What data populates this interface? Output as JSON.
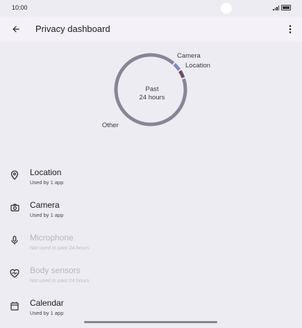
{
  "status_bar": {
    "time": "10:00",
    "icons": [
      "signal-icon",
      "battery-icon"
    ]
  },
  "app_bar": {
    "title": "Privacy dashboard",
    "back_icon": "arrow-back-icon",
    "menu_icon": "more-vert-icon"
  },
  "chart_data": {
    "type": "pie",
    "center_label_line1": "Past",
    "center_label_line2": "24 hours",
    "slices": [
      {
        "label": "Camera",
        "value": 4,
        "color": "#7d8bc9"
      },
      {
        "label": "Location",
        "value": 4,
        "color": "#6f4e60"
      },
      {
        "label": "Other",
        "value": 92,
        "color": "#878697"
      }
    ]
  },
  "permissions": [
    {
      "name": "Location",
      "subtitle": "Used by 1 app",
      "icon": "location-pin-icon",
      "enabled": true
    },
    {
      "name": "Camera",
      "subtitle": "Used by 1 app",
      "icon": "camera-icon",
      "enabled": true
    },
    {
      "name": "Microphone",
      "subtitle": "Not used in past 24 hours",
      "icon": "microphone-icon",
      "enabled": false
    },
    {
      "name": "Body sensors",
      "subtitle": "Not used in past 24 hours",
      "icon": "heart-pulse-icon",
      "enabled": false
    },
    {
      "name": "Calendar",
      "subtitle": "Used by 1 app",
      "icon": "calendar-icon",
      "enabled": true
    }
  ],
  "colors": {
    "background": "#eeecf3",
    "app_bar": "#f4f2f8",
    "text_primary": "#1c1b20",
    "text_disabled": "#b6b5bc"
  }
}
